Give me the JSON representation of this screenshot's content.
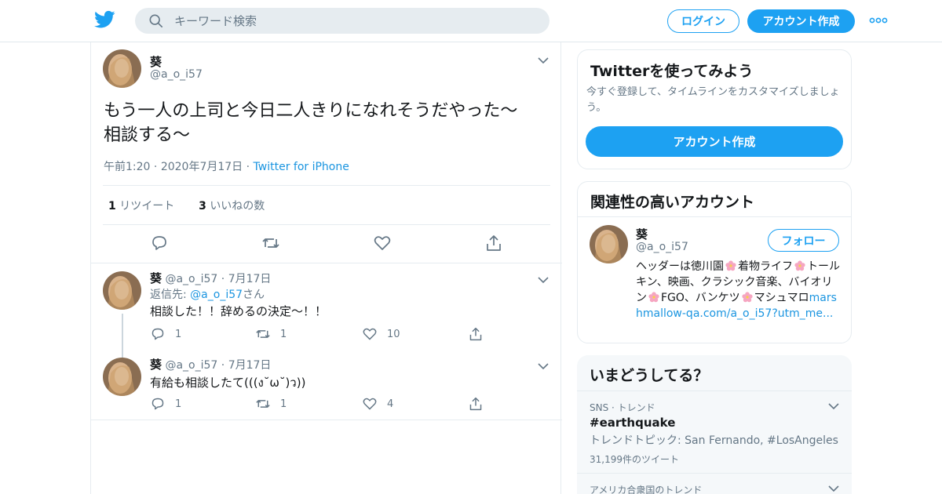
{
  "colors": {
    "accent": "#1da1f2",
    "link": "#1b95e0",
    "secondary_text": "#657786",
    "border": "#e6ecf0",
    "trend_bg": "#f5f8fa"
  },
  "header": {
    "logo_icon": "twitter-bird-icon",
    "search_placeholder": "キーワード検索",
    "login_label": "ログイン",
    "signup_label": "アカウント作成",
    "more_icon": "more-dots-icon"
  },
  "tweet": {
    "name": "葵",
    "handle": "@a_o_i57",
    "text_line1": "もう一人の上司と今日二人きりになれそうだやった〜",
    "text_line2": "相談する〜",
    "time": "午前1:20",
    "date": "2020年7月17日",
    "source": "Twitter for iPhone",
    "retweet_count": "1",
    "retweet_label": "リツイート",
    "like_count": "3",
    "like_label": "いいねの数"
  },
  "replies": [
    {
      "name": "葵",
      "handle": "@a_o_i57",
      "date": "7月17日",
      "reply_prefix": "返信先: ",
      "reply_to": "@a_o_i57",
      "reply_suffix": "さん",
      "text": "相談した！！辞めるの決定〜！！",
      "reply_count": "1",
      "retweet_count": "1",
      "like_count": "10"
    },
    {
      "name": "葵",
      "handle": "@a_o_i57",
      "date": "7月17日",
      "text": "有給も相談したて(((ง˘ω˘)ว))",
      "reply_count": "1",
      "retweet_count": "1",
      "like_count": "4"
    }
  ],
  "signup_card": {
    "title": "Twitterを使ってみよう",
    "description": "今すぐ登録して、タイムラインをカスタマイズしましょう。",
    "button": "アカウント作成"
  },
  "relevant": {
    "title": "関連性の高いアカウント",
    "name": "葵",
    "handle": "@a_o_i57",
    "follow": "フォロー",
    "bio_1": "ヘッダーは徳川園",
    "bio_2": "着物ライフ",
    "bio_3": "トールキン、映画、クラシック音楽、バイオリン",
    "bio_4": "FGO、バンケツ",
    "bio_5": "マシュマロ",
    "bio_link": "marshmallow-qa.com/a_o_i57?utm_me..."
  },
  "trends": {
    "title": "いまどうしてる？",
    "items": [
      {
        "meta": "SNS · トレンド",
        "tag": "#earthquake",
        "desc": "トレンドトピック: San Fernando, #LosAngeles",
        "count": "31,199件のツイート"
      },
      {
        "meta": "アメリカ合衆国のトレンド"
      }
    ]
  }
}
